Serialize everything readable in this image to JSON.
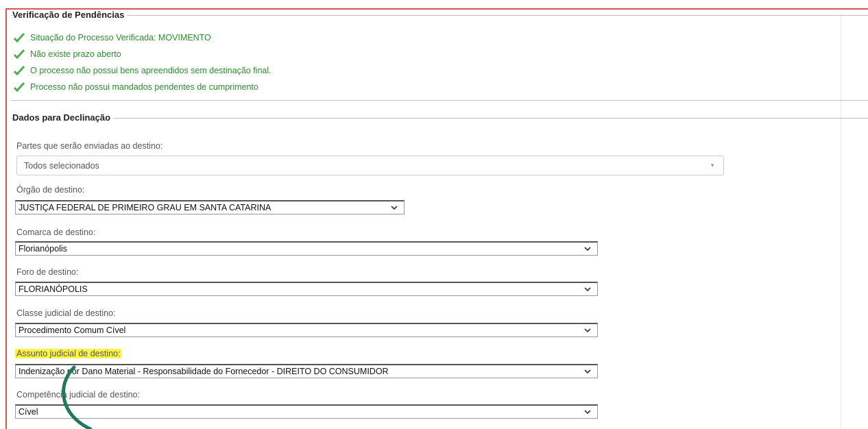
{
  "pendencias": {
    "legend": "Verificação de Pendências",
    "items": [
      "Situação do Processo Verificada: MOVIMENTO",
      "Não existe prazo aberto",
      "O processo não possui bens apreendidos sem destinação final.",
      "Processo não possui mandados pendentes de cumprimento"
    ],
    "icon": "check-icon",
    "color": "#2e8b2e"
  },
  "declinacao": {
    "legend": "Dados para Declinação",
    "partes": {
      "label": "Partes que serão enviadas ao destino:",
      "value": "Todos selecionados"
    },
    "orgao": {
      "label": "Órgão de destino:",
      "value": "JUSTIÇA FEDERAL DE PRIMEIRO GRAU EM SANTA CATARINA"
    },
    "comarca": {
      "label": "Comarca de destino:",
      "value": "Florianópolis"
    },
    "foro": {
      "label": "Foro de destino:",
      "value": "FLORIANÓPOLIS"
    },
    "classe": {
      "label": "Classe judicial de destino:",
      "value": "Procedimento Comum Cível"
    },
    "assunto": {
      "label": "Assunto judicial de destino:",
      "value": "Indenização por Dano Material - Responsabilidade do Fornecedor - DIREITO DO CONSUMIDOR",
      "highlight": "#fbf34a"
    },
    "competencia": {
      "label": "Competência judicial de destino:",
      "value": "Cível"
    }
  },
  "annotation_color": "#1e7a5a",
  "frame_color": "#d9534f"
}
